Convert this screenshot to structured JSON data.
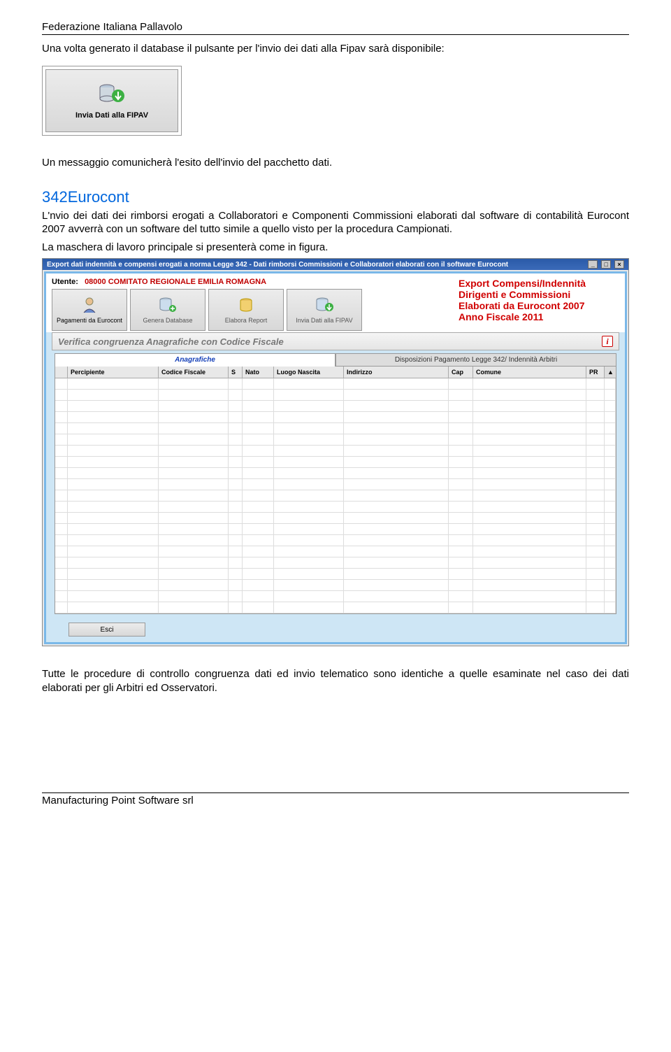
{
  "header": {
    "org": "Federazione Italiana Pallavolo"
  },
  "intro": "Una volta generato il database il pulsante per l'invio dei dati alla Fipav sarà disponibile:",
  "inviaBtn": {
    "label": "Invia Dati alla FIPAV"
  },
  "msg": "Un messaggio comunicherà l'esito dell'invio del pacchetto dati.",
  "section": {
    "title": "342Eurocont",
    "body": "L'nvio dei dati dei rimborsi erogati a Collaboratori e Componenti Commissioni elaborati dal software di contabilità Eurocont 2007 avverrà con un software del tutto simile a quello visto per la procedura Campionati.",
    "body2": "La maschera di lavoro principale si presenterà come in figura."
  },
  "screenshot": {
    "titlebar": "Export dati indennità e compensi erogati a norma Legge 342 - Dati rimborsi Commissioni e Collaboratori  elaborati con il software Eurocont",
    "utente_label": "Utente:",
    "utente_value": "08000 COMITATO REGIONALE EMILIA ROMAGNA",
    "red_title_l1": "Export Compensi/Indennità",
    "red_title_l2": "Dirigenti e Commissioni",
    "red_title_l3": "Elaborati da Eurocont 2007",
    "red_title_l4": "Anno Fiscale 2011",
    "toolbar": [
      {
        "label": "Pagamenti da Eurocont"
      },
      {
        "label": "Genera Database"
      },
      {
        "label": "Elabora Report"
      },
      {
        "label": "Invia Dati alla FIPAV"
      }
    ],
    "verify": "Verifica congruenza Anagrafiche con Codice Fiscale",
    "tabs": {
      "t1": "Anagrafiche",
      "t2": "Disposizioni Pagamento Legge 342/ Indennità Arbitri"
    },
    "columns": [
      "Percipiente",
      "Codice Fiscale",
      "S",
      "Nato",
      "Luogo Nascita",
      "Indirizzo",
      "Cap",
      "Comune",
      "PR"
    ],
    "esci": "Esci"
  },
  "conclusion": "Tutte le procedure di controllo congruenza dati ed invio telematico sono identiche a quelle esaminate nel caso dei dati elaborati per gli Arbitri ed Osservatori.",
  "footer": {
    "org": "Manufacturing Point Software srl"
  },
  "colors": {
    "link": "#0066dd",
    "red": "#d00000"
  }
}
